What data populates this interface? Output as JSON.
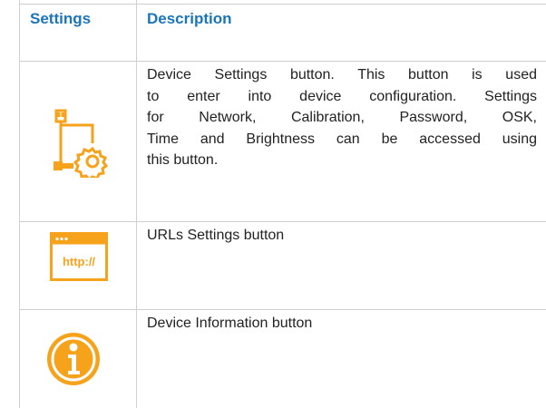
{
  "table": {
    "headers": {
      "settings": "Settings",
      "description": "Description"
    },
    "rows": [
      {
        "icon": "device-settings-icon",
        "lines": [
          "Device Settings button. This button is used",
          "to enter into device configuration. Settings",
          "for Network, Calibration, Password, OSK,",
          "Time and Brightness can be accessed using",
          "this button."
        ]
      },
      {
        "icon": "urls-settings-icon",
        "icon_text": "http://",
        "lines": [
          "URLs Settings button"
        ]
      },
      {
        "icon": "info-icon",
        "lines": [
          "Device Information button"
        ]
      }
    ]
  },
  "colors": {
    "header_text": "#1b75bb",
    "icon_accent": "#f7a21b",
    "border": "#cfcfcf"
  }
}
